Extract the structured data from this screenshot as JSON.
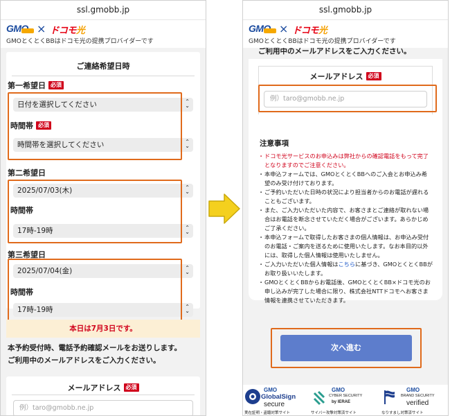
{
  "url": "ssl.gmobb.jp",
  "brand": {
    "gmo": "GMO",
    "times": "×",
    "docomo": "ドコモ",
    "hikari": "光",
    "tagline": "GMOとくとくBBはドコモ光の提携プロバイダーです"
  },
  "left": {
    "section_title": "ご連絡希望日時",
    "required_badge": "必須",
    "first_choice": {
      "label": "第一希望日",
      "date_value": "日付を選択してください",
      "time_label": "時間帯",
      "time_value": "時間帯を選択してください"
    },
    "second_choice": {
      "label": "第二希望日",
      "date_value": "2025/07/03(木)",
      "time_label": "時間帯",
      "time_value": "17時-19時"
    },
    "third_choice": {
      "label": "第三希望日",
      "date_value": "2025/07/04(金)",
      "time_label": "時間帯",
      "time_value": "17時-19時"
    },
    "today_notice": "本日は7月3日です。",
    "info_line1": "本予約受付時、電話予約確認メールをお送りします。",
    "info_line2": "ご利用中のメールアドレスをご入力ください。",
    "email_title": "メールアドレス",
    "email_placeholder": "例）taro@gmobb.ne.jp"
  },
  "right": {
    "info_line": "ご利用中のメールアドレスをご入力ください。",
    "email_title": "メールアドレス",
    "email_placeholder": "例）taro@gmobb.ne.jp",
    "notes_title": "注意事項",
    "notes": [
      {
        "text": "ドコモ光サービスのお申込みは弊社からの確認電話をもって完了となりますのでご注意ください。",
        "red": true
      },
      {
        "text": "本申込フォームでは、GMOとくとくBBへのご入会とお申込み希望のみ受け付けております。"
      },
      {
        "text": "ご予約いただいた日時の状況により担当者からのお電話が遅れることもございます。"
      },
      {
        "text": "また、ご入力いただいた内容で、お客さまとご連絡が取れない場合はお電話を断念させていただく場合がございます。あらかじめご了承ください。"
      },
      {
        "text": "本申込フォームで取得したお客さまの個人情報は、お申込み受付のお電話・ご案内を送るために使用いたします。なお本目的以外には、取得した個人情報は使用いたしません。"
      },
      {
        "pre": "ご入力いただいた個人情報は",
        "link": "こちら",
        "post": "に基づき、GMOとくとくBBがお取り扱いいたします。"
      },
      {
        "text": "GMOとくとくBBからお電話後、GMOとくとくBB×ドコモ光のお申し込みが完了した場合に限り、株式会社NTTドコモへお客さま情報を連携させていただきます。"
      }
    ],
    "next_button": "次へ進む"
  },
  "footer": {
    "globalsign": {
      "top": "GMO",
      "mid": "GlobalSign",
      "bot": "secure",
      "cap": "実在証明・盗聴対策サイト"
    },
    "cybersecurity": {
      "top": "GMO",
      "mid": "CYBER SECURITY",
      "bot": "by IERAE",
      "cap": "サイバー攻撃対策済サイト"
    },
    "brandsecurity": {
      "top": "GMO",
      "mid": "BRAND SECURITY",
      "bot": "verified",
      "cap": "なりすまし対策済サイト"
    }
  },
  "colors": {
    "highlight": "#e06a1b",
    "required": "#d0021b",
    "button": "#5d7dcc",
    "notice_bg": "#fcefd5",
    "link": "#1a56c8",
    "arrow": "#f4d01e"
  },
  "icons": {
    "select_chevron": "chevron-up-down-icon",
    "arrow": "right-arrow-icon"
  }
}
